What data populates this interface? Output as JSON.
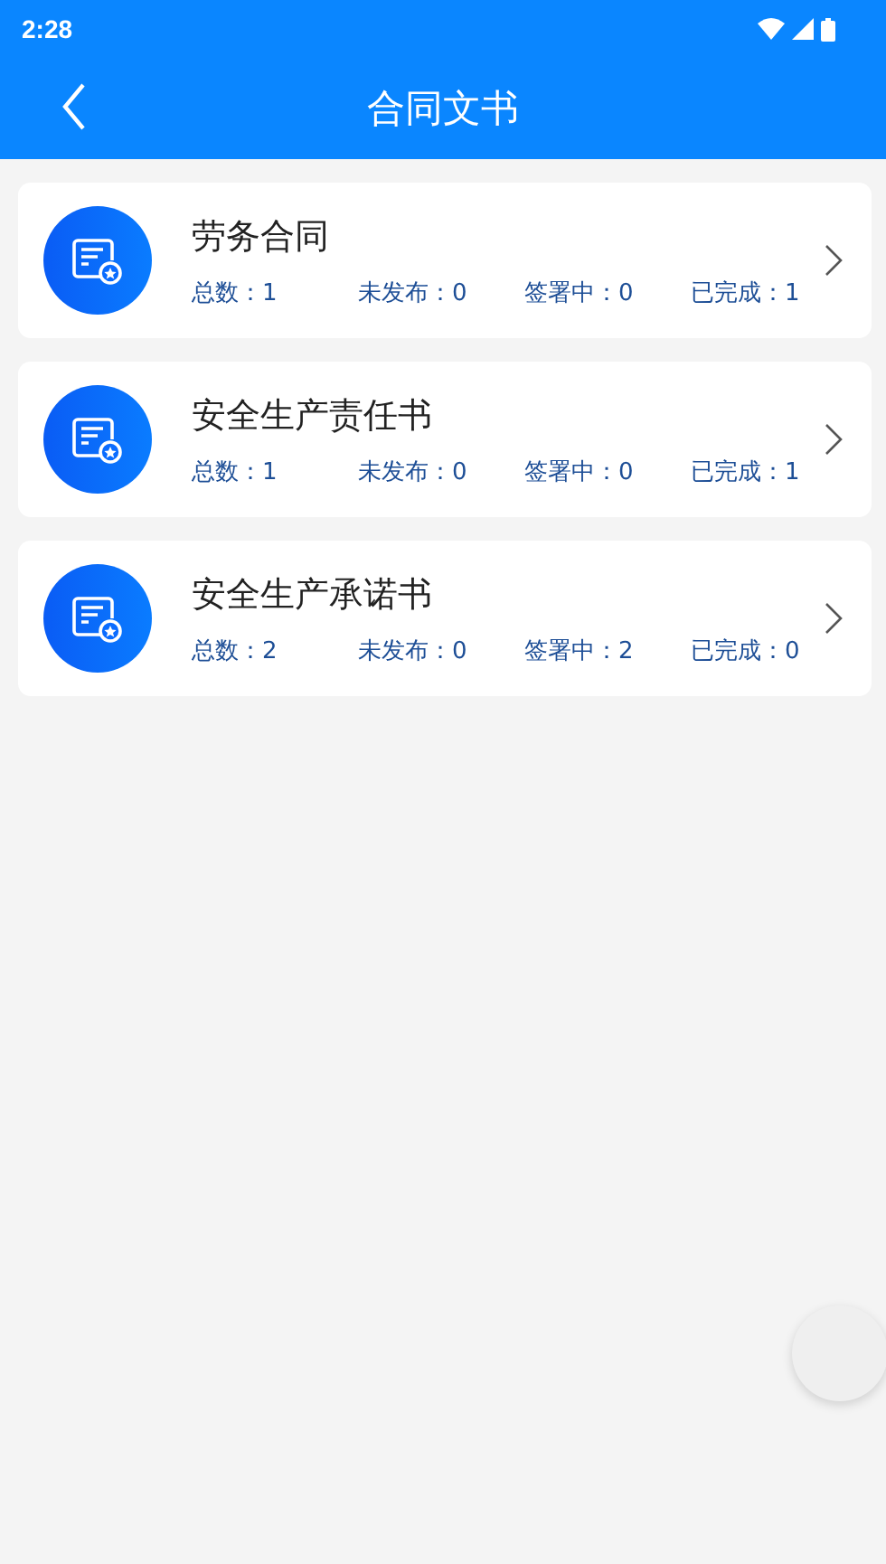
{
  "status_bar": {
    "time": "2:28"
  },
  "header": {
    "title": "合同文书"
  },
  "items": [
    {
      "title": "劳务合同",
      "stats": [
        "总数：1",
        "未发布：0",
        "签署中：0",
        "已完成：1"
      ]
    },
    {
      "title": "安全生产责任书",
      "stats": [
        "总数：1",
        "未发布：0",
        "签署中：0",
        "已完成：1"
      ]
    },
    {
      "title": "安全生产承诺书",
      "stats": [
        "总数：2",
        "未发布：0",
        "签署中：2",
        "已完成：0"
      ]
    }
  ]
}
